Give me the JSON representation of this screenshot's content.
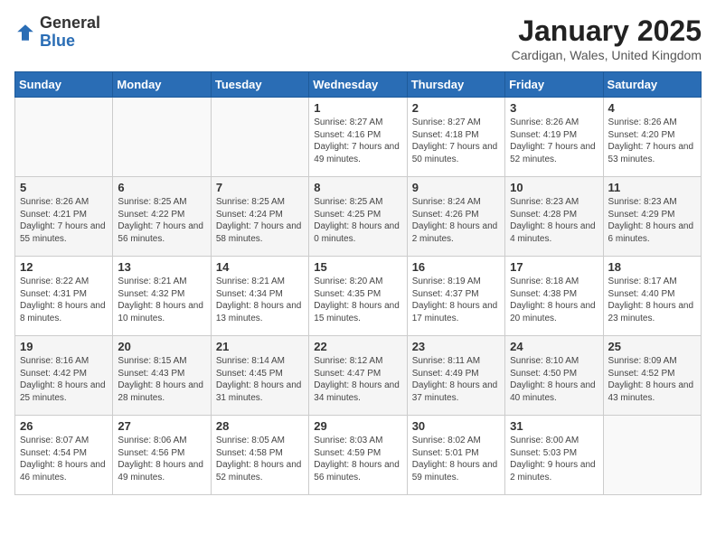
{
  "header": {
    "logo_general": "General",
    "logo_blue": "Blue",
    "month_title": "January 2025",
    "location": "Cardigan, Wales, United Kingdom"
  },
  "days_of_week": [
    "Sunday",
    "Monday",
    "Tuesday",
    "Wednesday",
    "Thursday",
    "Friday",
    "Saturday"
  ],
  "weeks": [
    [
      {
        "day": "",
        "info": ""
      },
      {
        "day": "",
        "info": ""
      },
      {
        "day": "",
        "info": ""
      },
      {
        "day": "1",
        "info": "Sunrise: 8:27 AM\nSunset: 4:16 PM\nDaylight: 7 hours and 49 minutes."
      },
      {
        "day": "2",
        "info": "Sunrise: 8:27 AM\nSunset: 4:18 PM\nDaylight: 7 hours and 50 minutes."
      },
      {
        "day": "3",
        "info": "Sunrise: 8:26 AM\nSunset: 4:19 PM\nDaylight: 7 hours and 52 minutes."
      },
      {
        "day": "4",
        "info": "Sunrise: 8:26 AM\nSunset: 4:20 PM\nDaylight: 7 hours and 53 minutes."
      }
    ],
    [
      {
        "day": "5",
        "info": "Sunrise: 8:26 AM\nSunset: 4:21 PM\nDaylight: 7 hours and 55 minutes."
      },
      {
        "day": "6",
        "info": "Sunrise: 8:25 AM\nSunset: 4:22 PM\nDaylight: 7 hours and 56 minutes."
      },
      {
        "day": "7",
        "info": "Sunrise: 8:25 AM\nSunset: 4:24 PM\nDaylight: 7 hours and 58 minutes."
      },
      {
        "day": "8",
        "info": "Sunrise: 8:25 AM\nSunset: 4:25 PM\nDaylight: 8 hours and 0 minutes."
      },
      {
        "day": "9",
        "info": "Sunrise: 8:24 AM\nSunset: 4:26 PM\nDaylight: 8 hours and 2 minutes."
      },
      {
        "day": "10",
        "info": "Sunrise: 8:23 AM\nSunset: 4:28 PM\nDaylight: 8 hours and 4 minutes."
      },
      {
        "day": "11",
        "info": "Sunrise: 8:23 AM\nSunset: 4:29 PM\nDaylight: 8 hours and 6 minutes."
      }
    ],
    [
      {
        "day": "12",
        "info": "Sunrise: 8:22 AM\nSunset: 4:31 PM\nDaylight: 8 hours and 8 minutes."
      },
      {
        "day": "13",
        "info": "Sunrise: 8:21 AM\nSunset: 4:32 PM\nDaylight: 8 hours and 10 minutes."
      },
      {
        "day": "14",
        "info": "Sunrise: 8:21 AM\nSunset: 4:34 PM\nDaylight: 8 hours and 13 minutes."
      },
      {
        "day": "15",
        "info": "Sunrise: 8:20 AM\nSunset: 4:35 PM\nDaylight: 8 hours and 15 minutes."
      },
      {
        "day": "16",
        "info": "Sunrise: 8:19 AM\nSunset: 4:37 PM\nDaylight: 8 hours and 17 minutes."
      },
      {
        "day": "17",
        "info": "Sunrise: 8:18 AM\nSunset: 4:38 PM\nDaylight: 8 hours and 20 minutes."
      },
      {
        "day": "18",
        "info": "Sunrise: 8:17 AM\nSunset: 4:40 PM\nDaylight: 8 hours and 23 minutes."
      }
    ],
    [
      {
        "day": "19",
        "info": "Sunrise: 8:16 AM\nSunset: 4:42 PM\nDaylight: 8 hours and 25 minutes."
      },
      {
        "day": "20",
        "info": "Sunrise: 8:15 AM\nSunset: 4:43 PM\nDaylight: 8 hours and 28 minutes."
      },
      {
        "day": "21",
        "info": "Sunrise: 8:14 AM\nSunset: 4:45 PM\nDaylight: 8 hours and 31 minutes."
      },
      {
        "day": "22",
        "info": "Sunrise: 8:12 AM\nSunset: 4:47 PM\nDaylight: 8 hours and 34 minutes."
      },
      {
        "day": "23",
        "info": "Sunrise: 8:11 AM\nSunset: 4:49 PM\nDaylight: 8 hours and 37 minutes."
      },
      {
        "day": "24",
        "info": "Sunrise: 8:10 AM\nSunset: 4:50 PM\nDaylight: 8 hours and 40 minutes."
      },
      {
        "day": "25",
        "info": "Sunrise: 8:09 AM\nSunset: 4:52 PM\nDaylight: 8 hours and 43 minutes."
      }
    ],
    [
      {
        "day": "26",
        "info": "Sunrise: 8:07 AM\nSunset: 4:54 PM\nDaylight: 8 hours and 46 minutes."
      },
      {
        "day": "27",
        "info": "Sunrise: 8:06 AM\nSunset: 4:56 PM\nDaylight: 8 hours and 49 minutes."
      },
      {
        "day": "28",
        "info": "Sunrise: 8:05 AM\nSunset: 4:58 PM\nDaylight: 8 hours and 52 minutes."
      },
      {
        "day": "29",
        "info": "Sunrise: 8:03 AM\nSunset: 4:59 PM\nDaylight: 8 hours and 56 minutes."
      },
      {
        "day": "30",
        "info": "Sunrise: 8:02 AM\nSunset: 5:01 PM\nDaylight: 8 hours and 59 minutes."
      },
      {
        "day": "31",
        "info": "Sunrise: 8:00 AM\nSunset: 5:03 PM\nDaylight: 9 hours and 2 minutes."
      },
      {
        "day": "",
        "info": ""
      }
    ]
  ]
}
